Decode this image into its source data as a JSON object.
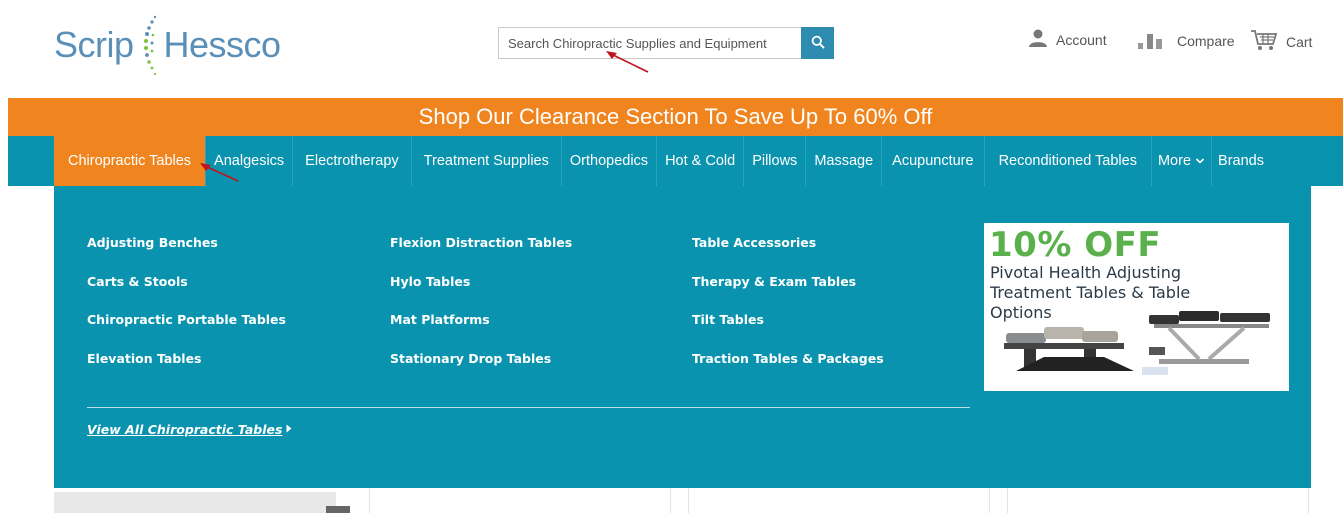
{
  "header": {
    "logo_left": "Scrip",
    "logo_right": "Hessco",
    "search": {
      "placeholder": "Search Chiropractic Supplies and Equipment",
      "value": ""
    },
    "account_label": "Account",
    "compare_label": "Compare",
    "cart_label": "Cart"
  },
  "promo_banner": "Shop Our Clearance Section To Save Up To 60% Off",
  "nav": {
    "items": [
      {
        "label": "Chiropractic Tables",
        "active": true
      },
      {
        "label": "Analgesics"
      },
      {
        "label": "Electrotherapy"
      },
      {
        "label": "Treatment Supplies"
      },
      {
        "label": "Orthopedics"
      },
      {
        "label": "Hot & Cold"
      },
      {
        "label": "Pillows"
      },
      {
        "label": "Massage"
      },
      {
        "label": "Acupuncture"
      },
      {
        "label": "Reconditioned Tables"
      },
      {
        "label": "More"
      },
      {
        "label": "Brands"
      }
    ]
  },
  "mega_menu": {
    "columns": [
      [
        "Adjusting Benches",
        "Carts & Stools",
        "Chiropractic Portable Tables",
        "Elevation Tables"
      ],
      [
        "Flexion Distraction Tables",
        "Hylo Tables",
        "Mat Platforms",
        "Stationary Drop Tables"
      ],
      [
        "Table Accessories",
        "Therapy & Exam Tables",
        "Tilt Tables",
        "Traction Tables & Packages"
      ]
    ],
    "view_all": "View All Chiropractic Tables",
    "ad": {
      "headline": "10% OFF",
      "text": "Pivotal Health Adjusting Treatment Tables & Table Options"
    }
  },
  "colors": {
    "brand_blue": "#0a93af",
    "accent_orange": "#f0851f",
    "ad_green": "#5ab04a",
    "logo_blue": "#5a8fb8"
  }
}
